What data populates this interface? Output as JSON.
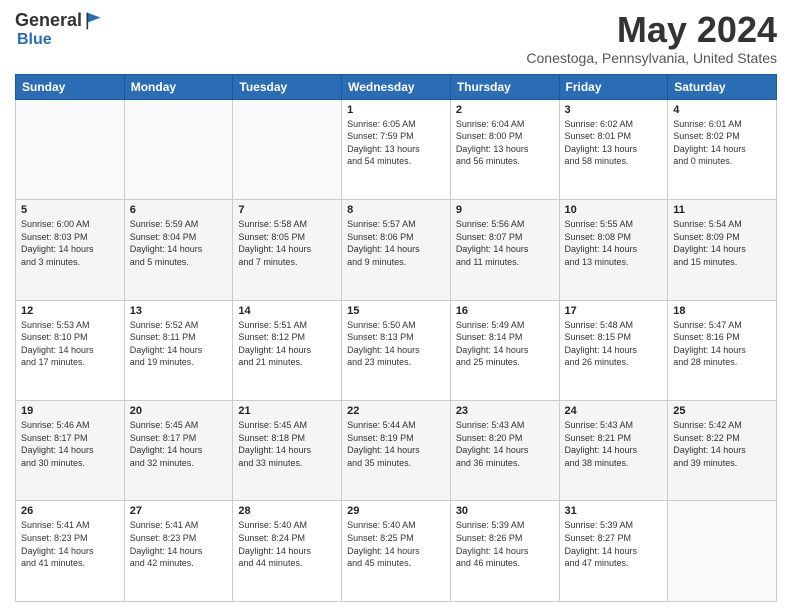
{
  "logo": {
    "general": "General",
    "blue": "Blue"
  },
  "title": "May 2024",
  "location": "Conestoga, Pennsylvania, United States",
  "headers": [
    "Sunday",
    "Monday",
    "Tuesday",
    "Wednesday",
    "Thursday",
    "Friday",
    "Saturday"
  ],
  "weeks": [
    [
      {
        "day": "",
        "info": ""
      },
      {
        "day": "",
        "info": ""
      },
      {
        "day": "",
        "info": ""
      },
      {
        "day": "1",
        "info": "Sunrise: 6:05 AM\nSunset: 7:59 PM\nDaylight: 13 hours\nand 54 minutes."
      },
      {
        "day": "2",
        "info": "Sunrise: 6:04 AM\nSunset: 8:00 PM\nDaylight: 13 hours\nand 56 minutes."
      },
      {
        "day": "3",
        "info": "Sunrise: 6:02 AM\nSunset: 8:01 PM\nDaylight: 13 hours\nand 58 minutes."
      },
      {
        "day": "4",
        "info": "Sunrise: 6:01 AM\nSunset: 8:02 PM\nDaylight: 14 hours\nand 0 minutes."
      }
    ],
    [
      {
        "day": "5",
        "info": "Sunrise: 6:00 AM\nSunset: 8:03 PM\nDaylight: 14 hours\nand 3 minutes."
      },
      {
        "day": "6",
        "info": "Sunrise: 5:59 AM\nSunset: 8:04 PM\nDaylight: 14 hours\nand 5 minutes."
      },
      {
        "day": "7",
        "info": "Sunrise: 5:58 AM\nSunset: 8:05 PM\nDaylight: 14 hours\nand 7 minutes."
      },
      {
        "day": "8",
        "info": "Sunrise: 5:57 AM\nSunset: 8:06 PM\nDaylight: 14 hours\nand 9 minutes."
      },
      {
        "day": "9",
        "info": "Sunrise: 5:56 AM\nSunset: 8:07 PM\nDaylight: 14 hours\nand 11 minutes."
      },
      {
        "day": "10",
        "info": "Sunrise: 5:55 AM\nSunset: 8:08 PM\nDaylight: 14 hours\nand 13 minutes."
      },
      {
        "day": "11",
        "info": "Sunrise: 5:54 AM\nSunset: 8:09 PM\nDaylight: 14 hours\nand 15 minutes."
      }
    ],
    [
      {
        "day": "12",
        "info": "Sunrise: 5:53 AM\nSunset: 8:10 PM\nDaylight: 14 hours\nand 17 minutes."
      },
      {
        "day": "13",
        "info": "Sunrise: 5:52 AM\nSunset: 8:11 PM\nDaylight: 14 hours\nand 19 minutes."
      },
      {
        "day": "14",
        "info": "Sunrise: 5:51 AM\nSunset: 8:12 PM\nDaylight: 14 hours\nand 21 minutes."
      },
      {
        "day": "15",
        "info": "Sunrise: 5:50 AM\nSunset: 8:13 PM\nDaylight: 14 hours\nand 23 minutes."
      },
      {
        "day": "16",
        "info": "Sunrise: 5:49 AM\nSunset: 8:14 PM\nDaylight: 14 hours\nand 25 minutes."
      },
      {
        "day": "17",
        "info": "Sunrise: 5:48 AM\nSunset: 8:15 PM\nDaylight: 14 hours\nand 26 minutes."
      },
      {
        "day": "18",
        "info": "Sunrise: 5:47 AM\nSunset: 8:16 PM\nDaylight: 14 hours\nand 28 minutes."
      }
    ],
    [
      {
        "day": "19",
        "info": "Sunrise: 5:46 AM\nSunset: 8:17 PM\nDaylight: 14 hours\nand 30 minutes."
      },
      {
        "day": "20",
        "info": "Sunrise: 5:45 AM\nSunset: 8:17 PM\nDaylight: 14 hours\nand 32 minutes."
      },
      {
        "day": "21",
        "info": "Sunrise: 5:45 AM\nSunset: 8:18 PM\nDaylight: 14 hours\nand 33 minutes."
      },
      {
        "day": "22",
        "info": "Sunrise: 5:44 AM\nSunset: 8:19 PM\nDaylight: 14 hours\nand 35 minutes."
      },
      {
        "day": "23",
        "info": "Sunrise: 5:43 AM\nSunset: 8:20 PM\nDaylight: 14 hours\nand 36 minutes."
      },
      {
        "day": "24",
        "info": "Sunrise: 5:43 AM\nSunset: 8:21 PM\nDaylight: 14 hours\nand 38 minutes."
      },
      {
        "day": "25",
        "info": "Sunrise: 5:42 AM\nSunset: 8:22 PM\nDaylight: 14 hours\nand 39 minutes."
      }
    ],
    [
      {
        "day": "26",
        "info": "Sunrise: 5:41 AM\nSunset: 8:23 PM\nDaylight: 14 hours\nand 41 minutes."
      },
      {
        "day": "27",
        "info": "Sunrise: 5:41 AM\nSunset: 8:23 PM\nDaylight: 14 hours\nand 42 minutes."
      },
      {
        "day": "28",
        "info": "Sunrise: 5:40 AM\nSunset: 8:24 PM\nDaylight: 14 hours\nand 44 minutes."
      },
      {
        "day": "29",
        "info": "Sunrise: 5:40 AM\nSunset: 8:25 PM\nDaylight: 14 hours\nand 45 minutes."
      },
      {
        "day": "30",
        "info": "Sunrise: 5:39 AM\nSunset: 8:26 PM\nDaylight: 14 hours\nand 46 minutes."
      },
      {
        "day": "31",
        "info": "Sunrise: 5:39 AM\nSunset: 8:27 PM\nDaylight: 14 hours\nand 47 minutes."
      },
      {
        "day": "",
        "info": ""
      }
    ]
  ]
}
